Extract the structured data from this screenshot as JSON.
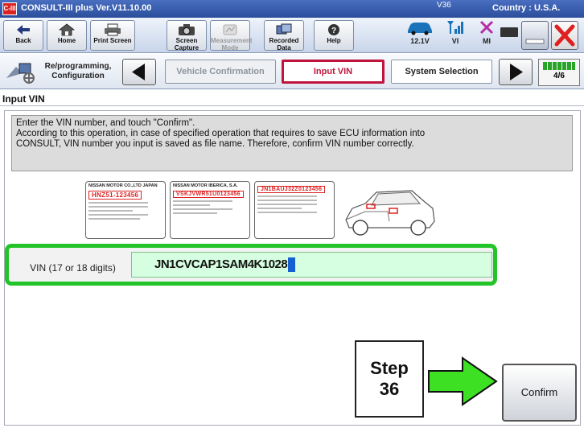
{
  "titlebar": {
    "logo": "C-III",
    "title": "CONSULT-III plus  Ver.V11.10.00",
    "model": "V36",
    "country": "Country : U.S.A."
  },
  "toolbar": {
    "buttons": [
      {
        "label": "Back",
        "icon": "back-arrow-icon"
      },
      {
        "label": "Home",
        "icon": "home-icon"
      },
      {
        "label": "Print Screen",
        "icon": "printer-icon"
      },
      {
        "label": "Screen Capture",
        "icon": "camera-icon"
      },
      {
        "label": "Measurement Mode",
        "icon": "measurement-icon"
      },
      {
        "label": "Recorded Data",
        "icon": "recorded-data-icon"
      },
      {
        "label": "Help",
        "icon": "help-icon"
      }
    ],
    "voltage": "12.1V",
    "vi_label": "VI",
    "mi_label": "MI"
  },
  "stepbar": {
    "section_label": "Re/programming, Configuration",
    "steps": [
      {
        "label": "Vehicle Confirmation",
        "state": "done"
      },
      {
        "label": "Input VIN",
        "state": "active"
      },
      {
        "label": "System Selection",
        "state": "next"
      }
    ],
    "progress": "4/6",
    "progress_fraction": 0.67
  },
  "page_title": "Input VIN",
  "instructions": {
    "line1": "Enter the VIN number, and touch \"Confirm\".",
    "line2": "According to this operation, in case of specified operation that requires to save ECU information into",
    "line3": "CONSULT, VIN number you input is saved as file name. Therefore, confirm VIN number correctly."
  },
  "plates": {
    "plate1_header": "NISSAN MOTOR CO.,LTD JAPAN",
    "plate1_vin": "HNZ51-123456",
    "plate2_header": "NISSAN MOTOR IBERICA, S.A.",
    "plate2_vin": "VSKJVWR51U0123456",
    "plate3_vin": "JN1BAUJ32Z0123456"
  },
  "vin_input": {
    "label": "VIN (17 or 18 digits)",
    "value": "JN1CVCAP1SAM4K1028"
  },
  "callout": {
    "line1": "Step",
    "line2": "36"
  },
  "confirm_label": "Confirm",
  "colors": {
    "highlight": "#22c42a",
    "active_step": "#c0143c",
    "input_bg": "#d5ffe0"
  }
}
